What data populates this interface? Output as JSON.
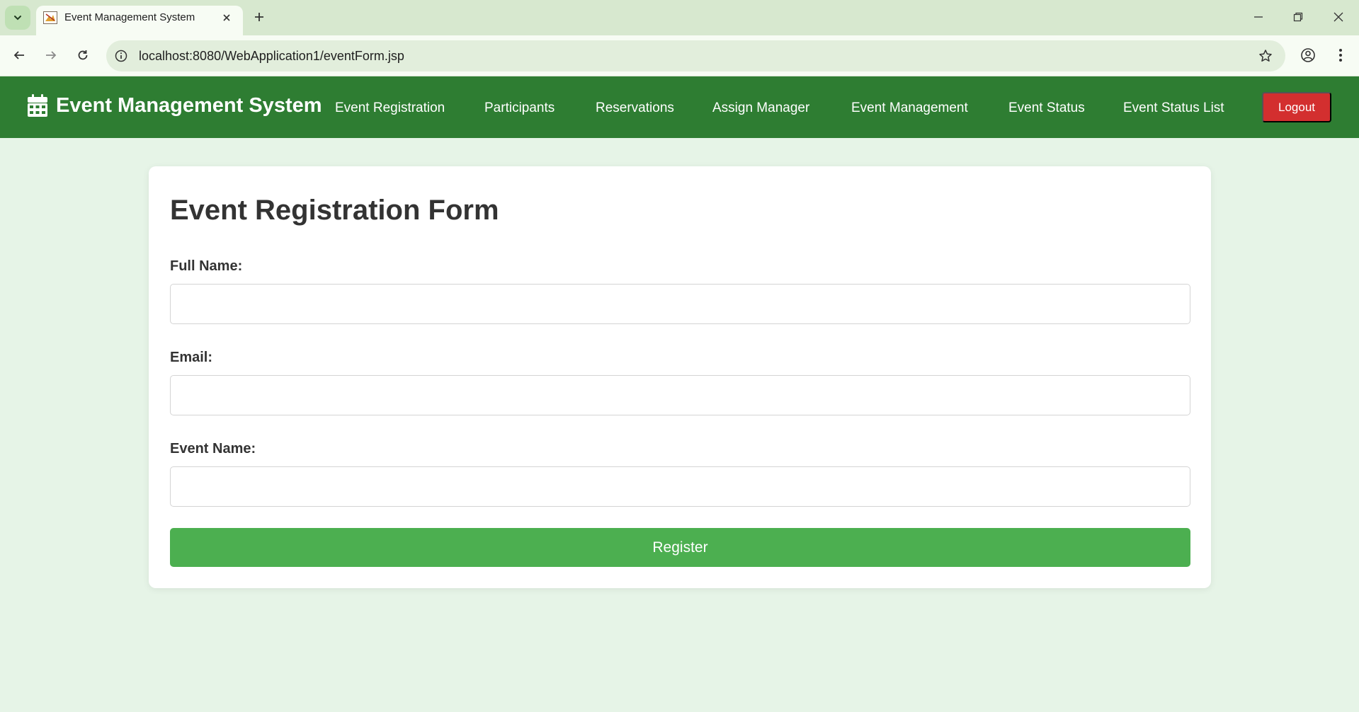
{
  "browser": {
    "tab_title": "Event Management System",
    "url": "localhost:8080/WebApplication1/eventForm.jsp"
  },
  "nav": {
    "brand": "Event Management System",
    "brand_icon": "calendar-icon",
    "links": [
      "Event Registration",
      "Participants",
      "Reservations",
      "Assign Manager",
      "Event Management",
      "Event Status",
      "Event Status List"
    ],
    "logout": "Logout"
  },
  "form": {
    "title": "Event Registration Form",
    "fields": [
      {
        "label": "Full Name:",
        "value": ""
      },
      {
        "label": "Email:",
        "value": ""
      },
      {
        "label": "Event Name:",
        "value": ""
      }
    ],
    "submit": "Register"
  },
  "colors": {
    "nav_bg": "#2e7d32",
    "page_bg": "#e6f4e7",
    "submit_bg": "#4caf50",
    "logout_bg": "#d32f2f"
  }
}
